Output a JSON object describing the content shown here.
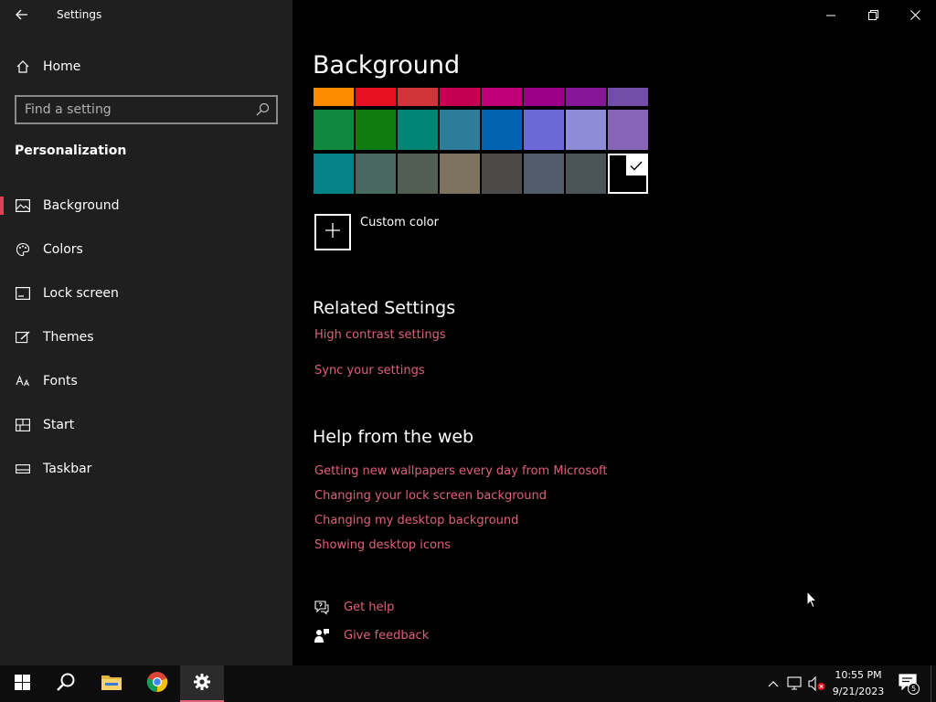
{
  "window": {
    "title": "Settings"
  },
  "sidebar": {
    "home_label": "Home",
    "search_placeholder": "Find a setting",
    "section": "Personalization",
    "items": [
      {
        "label": "Background",
        "icon": "image-icon",
        "selected": true
      },
      {
        "label": "Colors",
        "icon": "palette-icon",
        "selected": false
      },
      {
        "label": "Lock screen",
        "icon": "lock-screen-icon",
        "selected": false
      },
      {
        "label": "Themes",
        "icon": "themes-brush-icon",
        "selected": false
      },
      {
        "label": "Fonts",
        "icon": "fonts-icon",
        "selected": false
      },
      {
        "label": "Start",
        "icon": "start-layout-icon",
        "selected": false
      },
      {
        "label": "Taskbar",
        "icon": "taskbar-icon",
        "selected": false
      }
    ]
  },
  "main": {
    "title": "Background",
    "swatch_rows": [
      [
        "#ff8c00",
        "#e81123",
        "#d13438",
        "#c30052",
        "#bf0077",
        "#9a0089",
        "#881798",
        "#744da9"
      ],
      [
        "#10893e",
        "#107c10",
        "#018574",
        "#2d7d9a",
        "#0063b1",
        "#6b69d6",
        "#8e8cd8",
        "#8764b8"
      ],
      [
        "#038387",
        "#486860",
        "#525e54",
        "#7e735f",
        "#4c4a48",
        "#515c6b",
        "#4a5459",
        "#000000"
      ]
    ],
    "selected_swatch": "#000000",
    "custom_color_label": "Custom color",
    "related_title": "Related Settings",
    "related_links": [
      "High contrast settings",
      "Sync your settings"
    ],
    "help_title": "Help from the web",
    "help_links": [
      "Getting new wallpapers every day from Microsoft",
      "Changing your lock screen background",
      "Changing my desktop background",
      "Showing desktop icons"
    ],
    "get_help": "Get help",
    "give_feedback": "Give feedback"
  },
  "taskbar": {
    "time": "10:55 PM",
    "date": "9/21/2023",
    "notification_count": "5"
  },
  "colors": {
    "accent": "#e0607a",
    "sidebar_bg": "#1f1f1f",
    "taskbar_bg": "#0d0d0d"
  }
}
